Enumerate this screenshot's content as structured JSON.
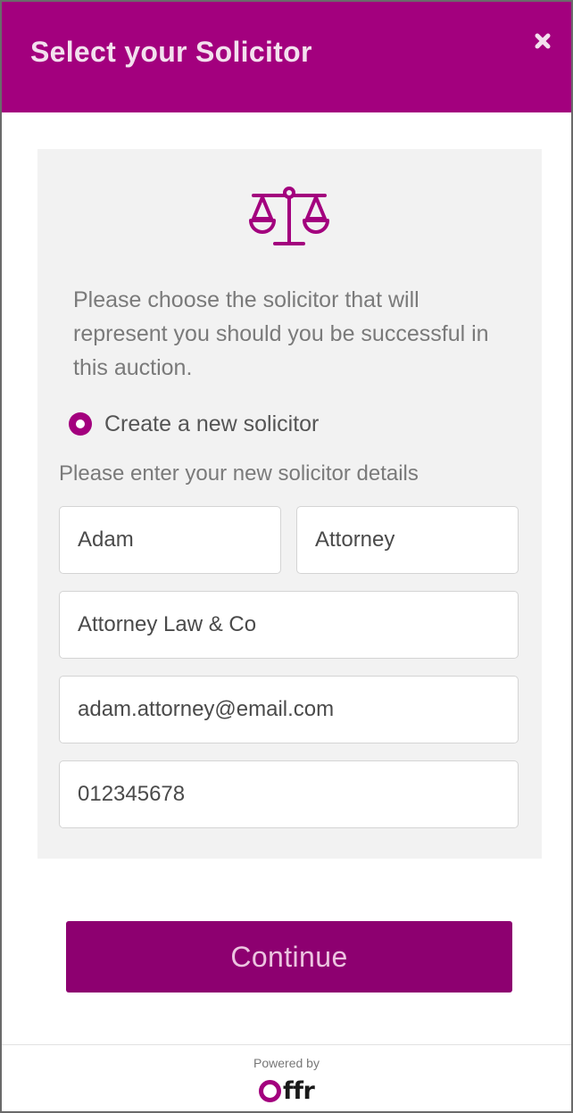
{
  "header": {
    "title": "Select your Solicitor",
    "close_icon": "close-icon"
  },
  "panel": {
    "icon": "scales-of-justice-icon",
    "intro": "Please choose the solicitor that will represent you should you be successful in this auction.",
    "radio_option": {
      "label": "Create a new solicitor",
      "selected": true
    },
    "section_label": "Please enter your new solicitor details",
    "fields": {
      "first_name": "Adam",
      "last_name": "Attorney",
      "firm": "Attorney Law & Co",
      "email": "adam.attorney@email.com",
      "phone": "012345678"
    }
  },
  "actions": {
    "continue_label": "Continue"
  },
  "footer": {
    "powered_by": "Powered by",
    "logo_text": "ffr"
  },
  "colors": {
    "brand": "#a3007e",
    "button": "#8d0070",
    "panel_bg": "#f2f2f2"
  }
}
